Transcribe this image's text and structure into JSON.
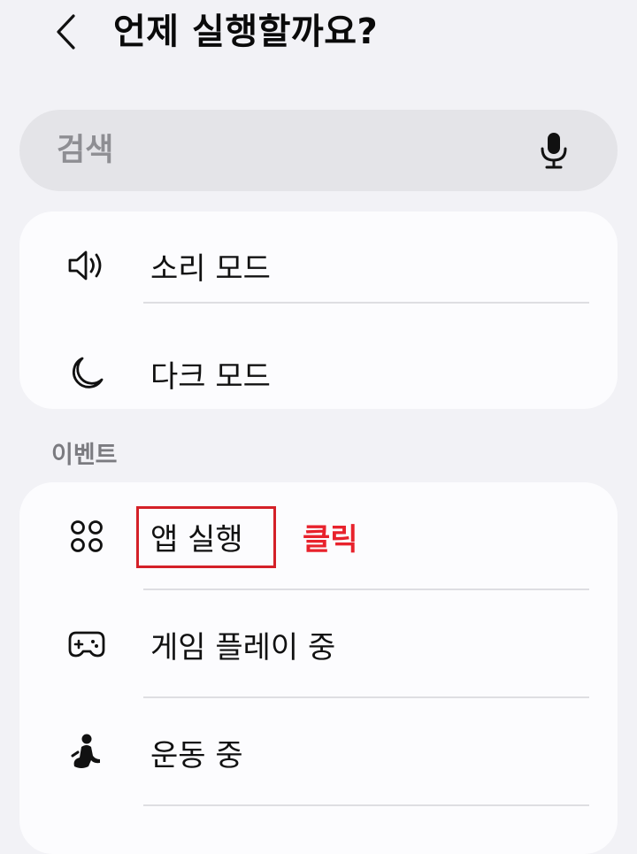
{
  "header": {
    "back_icon": "chevron-left-icon",
    "title": "언제 실행할까요?"
  },
  "search": {
    "placeholder": "검색",
    "mic_icon": "microphone-icon"
  },
  "modes": {
    "items": [
      {
        "label": "소리 모드",
        "icon": "speaker-icon"
      },
      {
        "label": "다크 모드",
        "icon": "moon-icon"
      }
    ]
  },
  "events": {
    "header": "이벤트",
    "items": [
      {
        "label": "앱 실행",
        "icon": "apps-grid-icon"
      },
      {
        "label": "게임 플레이 중",
        "icon": "gamepad-icon"
      },
      {
        "label": "운동 중",
        "icon": "runner-icon"
      }
    ]
  },
  "annotation": {
    "text": "클릭",
    "color": "#e8222c",
    "box_color": "#d42028"
  },
  "colors": {
    "background": "#f2f2f6",
    "card": "#fcfcfe",
    "search_bg": "#e4e4e8"
  }
}
